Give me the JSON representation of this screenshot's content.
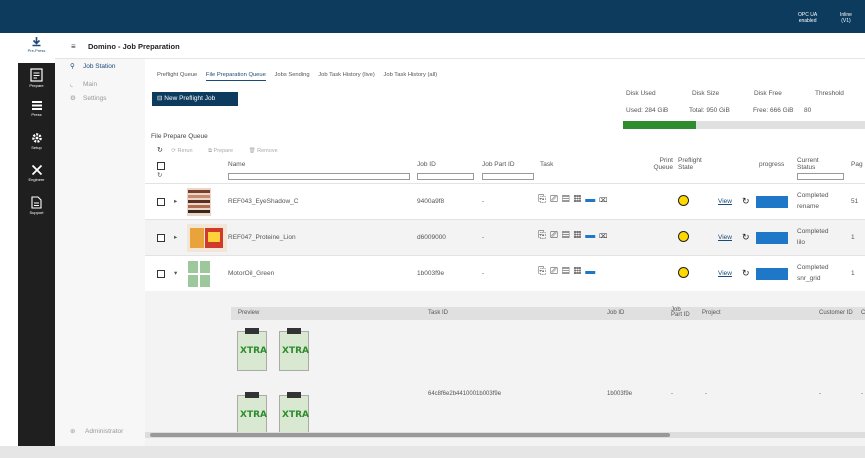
{
  "topbar": {
    "opc_line1": "OPC UA",
    "opc_line2": "enabled",
    "inline_line1": "Inline",
    "inline_line2": "(V1)"
  },
  "nav": [
    {
      "label": "Pre-Press",
      "icon": "download-icon",
      "active": true
    },
    {
      "label": "Prepare",
      "icon": "document-icon"
    },
    {
      "label": "Press",
      "icon": "list-icon"
    },
    {
      "label": "Setup",
      "icon": "gear-icon"
    },
    {
      "label": "Engineer",
      "icon": "tools-icon"
    },
    {
      "label": "Support",
      "icon": "support-doc-icon"
    }
  ],
  "header": {
    "title": "Domino - Job Preparation"
  },
  "sidebar": {
    "items": [
      {
        "label": "Job Station",
        "icon": "station-icon"
      },
      {
        "label": "Main",
        "icon": "chart-icon"
      },
      {
        "label": "Settings",
        "icon": "gear-icon"
      }
    ],
    "user": "Administrator"
  },
  "tabs": [
    "Preflight Queue",
    "File Preparation Queue",
    "Jobs Sending",
    "Job Task History (live)",
    "Job Task History (all)"
  ],
  "new_job_label": "New Preflight Job",
  "disk": {
    "headers": [
      "Disk Used",
      "Disk Size",
      "Disk Free",
      "Threshold"
    ],
    "values": [
      "Used: 284 GiB",
      "Total: 950 GiB",
      "Free: 666 GiB",
      "80"
    ],
    "used_fraction": 0.3,
    "colors": {
      "used": "#2e8b2e",
      "empty": "#e0e0e0"
    }
  },
  "queue_title": "File Prepare Queue",
  "toolbar": {
    "rerun": "Rerun",
    "prepare": "Prepare",
    "remove": "Remove"
  },
  "columns": {
    "name": "Name",
    "job_id": "Job ID",
    "job_part_id": "Job Part ID",
    "task": "Task",
    "print_queue": "Print Queue",
    "preflight_state": "Preflight State",
    "progress": "progress",
    "current_status": "Current Status",
    "pages": "Pag"
  },
  "rows": [
    {
      "name": "REF043_EyeShadow_C",
      "job_id": "9400a9f8",
      "job_part_id": "-",
      "view": "View",
      "status": "Completed",
      "status_sub": "rename",
      "pages": "51"
    },
    {
      "name": "REF047_Proteine_Lion",
      "job_id": "d6009000",
      "job_part_id": "-",
      "view": "View",
      "status": "Completed",
      "status_sub": "lilo",
      "pages": "1"
    },
    {
      "name": "MotorOil_Green",
      "job_id": "1b003f9e",
      "job_part_id": "-",
      "view": "View",
      "status": "Completed",
      "status_sub": "snr_grid",
      "pages": "1"
    }
  ],
  "detail": {
    "headers": {
      "preview": "Preview",
      "task_id": "Task ID",
      "job_id": "Job ID",
      "job_part_id": "Job Part ID",
      "project": "Project",
      "customer_id": "Customer ID",
      "more": "C"
    },
    "row": {
      "task_id": "64c8f6e2b4410001b003f9e",
      "job_id": "1b003f9e",
      "job_part_id": "-",
      "project": "-",
      "customer_id": "-",
      "more": "-"
    },
    "product_label": "XTRA"
  },
  "colors": {
    "brand": "#0d3b5e",
    "progress": "#1f77c8",
    "preflight_ok": "#ffd800"
  }
}
